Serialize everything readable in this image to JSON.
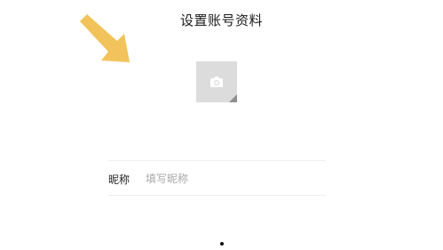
{
  "header": {
    "title": "设置账号资料"
  },
  "avatar": {
    "icon": "camera-icon"
  },
  "form": {
    "nickname_label": "昵称",
    "nickname_placeholder": "填写昵称",
    "nickname_value": ""
  },
  "annotation": {
    "icon": "arrow-pointer-icon",
    "color": "#f2c35a"
  },
  "pagination": {
    "active_page": 1,
    "total_pages": 1
  }
}
